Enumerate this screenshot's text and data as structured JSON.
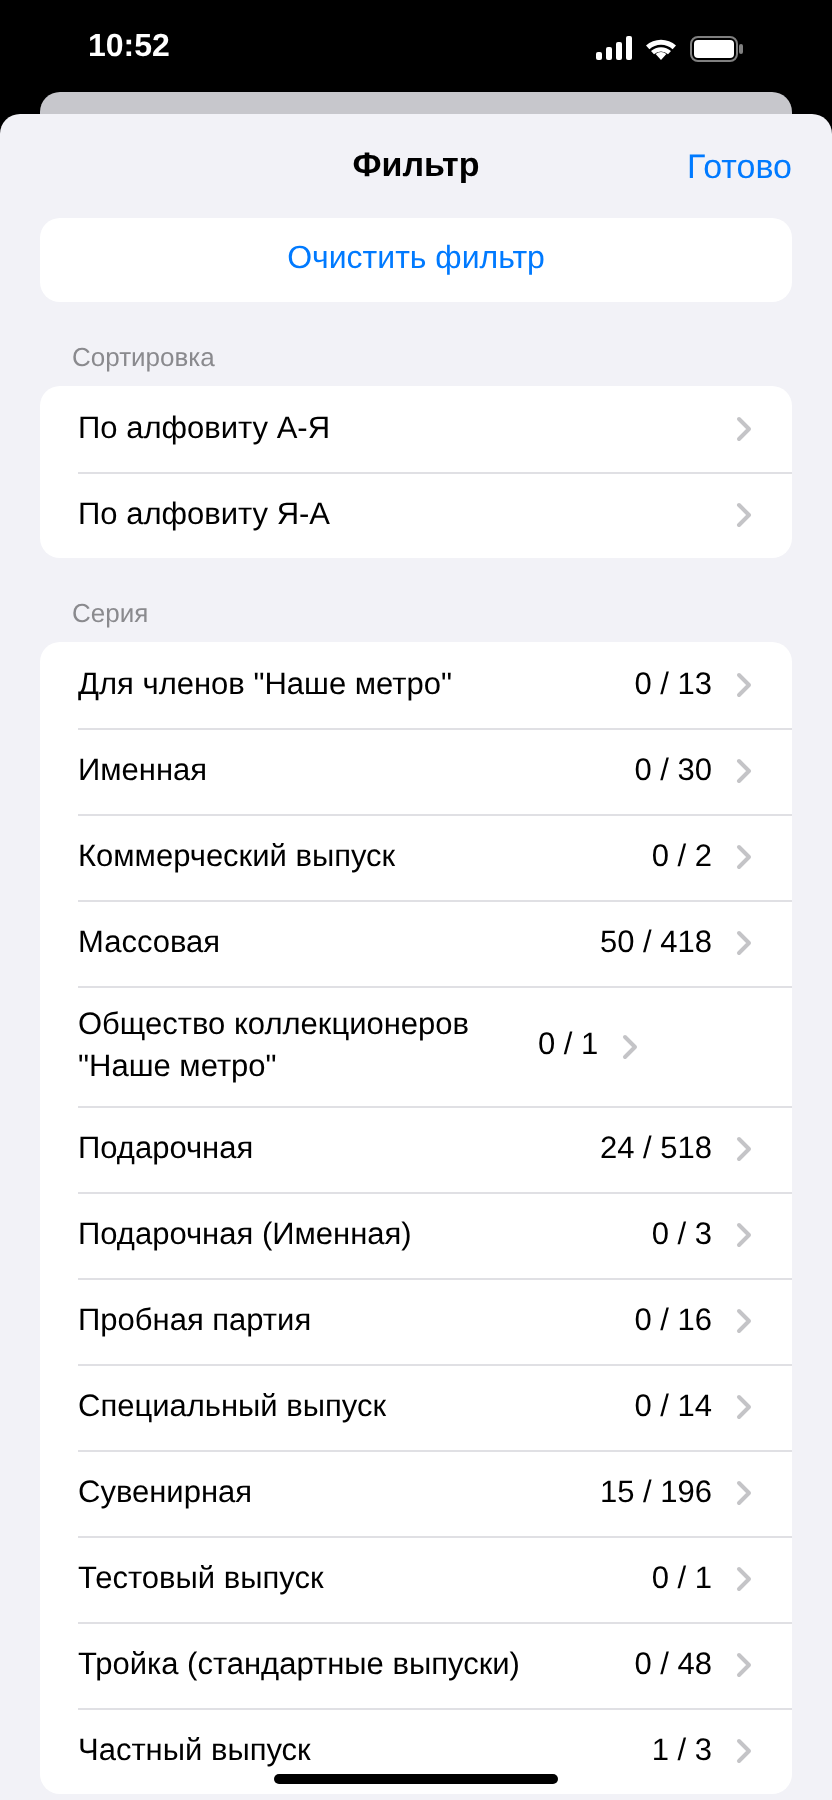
{
  "status_bar": {
    "time": "10:52"
  },
  "header": {
    "title": "Фильтр",
    "done": "Готово"
  },
  "clear_button": "Очистить фильтр",
  "sorting": {
    "title": "Сортировка",
    "items": [
      {
        "label": "По алфовиту А-Я"
      },
      {
        "label": "По алфовиту Я-А"
      }
    ]
  },
  "series": {
    "title": "Серия",
    "items": [
      {
        "label": "Для членов \"Наше метро\"",
        "count": "0 / 13"
      },
      {
        "label": "Именная",
        "count": "0 / 30"
      },
      {
        "label": "Коммерческий выпуск",
        "count": "0 / 2"
      },
      {
        "label": "Массовая",
        "count": "50 / 418"
      },
      {
        "label": "Общество коллекционеров \"Наше метро\"",
        "count": "0 / 1"
      },
      {
        "label": "Подарочная",
        "count": "24 / 518"
      },
      {
        "label": "Подарочная (Именная)",
        "count": "0 / 3"
      },
      {
        "label": "Пробная партия",
        "count": "0 / 16"
      },
      {
        "label": "Специальный выпуск",
        "count": "0 / 14"
      },
      {
        "label": "Сувенирная",
        "count": "15 / 196"
      },
      {
        "label": "Тестовый выпуск",
        "count": "0 / 1"
      },
      {
        "label": "Тройка (стандартные выпуски)",
        "count": "0 / 48"
      },
      {
        "label": "Частный выпуск",
        "count": "1 / 3"
      }
    ]
  }
}
